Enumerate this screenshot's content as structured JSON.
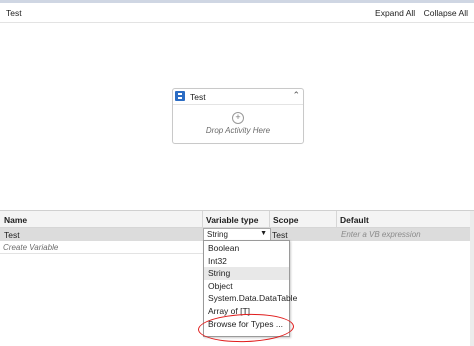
{
  "header": {
    "title": "Test",
    "expand_all": "Expand All",
    "collapse_all": "Collapse All"
  },
  "activity": {
    "title": "Test",
    "drop_text": "Drop Activity Here",
    "icon": "sequence-icon",
    "collapse_icon": "double-chevron-up-icon"
  },
  "grid": {
    "columns": [
      "Name",
      "Variable type",
      "Scope",
      "Default"
    ],
    "row": {
      "name": "Test",
      "type": "String",
      "scope": "Test",
      "default_placeholder": "Enter a VB expression"
    },
    "create_label": "Create Variable"
  },
  "dropdown": {
    "options": [
      "Boolean",
      "Int32",
      "String",
      "Object",
      "System.Data.DataTable",
      "Array of [T]",
      "Browse for Types ..."
    ],
    "selected": "String"
  },
  "colors": {
    "annotation_circle": "#e01c1c",
    "sequence_icon": "#2b6cc4"
  }
}
